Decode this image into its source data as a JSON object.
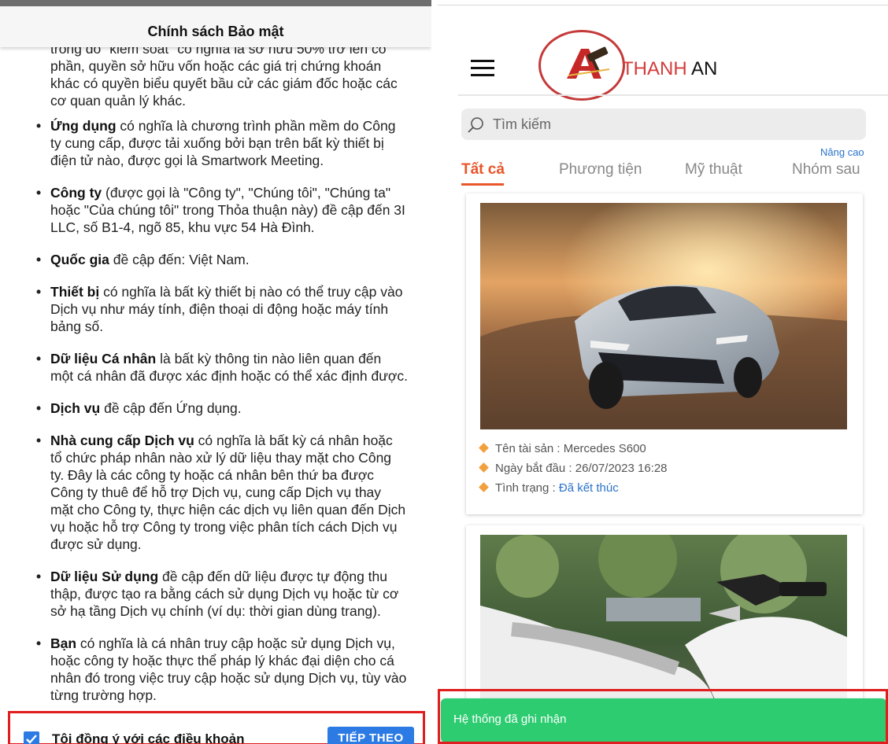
{
  "privacy": {
    "header_title": "Chính sách Bảo mật",
    "cut_paragraph": "trong đó \"kiểm soát\" có nghĩa là sở hữu 50% trở lên cổ phần, quyền sở hữu vốn hoặc các giá trị chứng khoán khác có quyền biểu quyết bầu cử các giám đốc hoặc các cơ quan quản lý khác.",
    "items": [
      {
        "term": "Ứng dụng",
        "text": " có nghĩa là chương trình phần mềm do Công ty cung cấp, được tải xuống bởi bạn trên bất kỳ thiết bị điện tử nào, được gọi là Smartwork Meeting."
      },
      {
        "term": "Công ty",
        "text": " (được gọi là \"Công ty\", \"Chúng tôi\", \"Chúng ta\" hoặc \"Của chúng tôi\" trong Thỏa thuận này) đề cập đến 3I LLC, số B1-4, ngõ 85, khu vực 54 Hà Đình."
      },
      {
        "term": "Quốc gia",
        "text": " đề cập đến: Việt Nam."
      },
      {
        "term": "Thiết bị",
        "text": " có nghĩa là bất kỳ thiết bị nào có thể truy cập vào Dịch vụ như máy tính, điện thoại di động hoặc máy tính bảng số."
      },
      {
        "term": "Dữ liệu Cá nhân",
        "text": " là bất kỳ thông tin nào liên quan đến một cá nhân đã được xác định hoặc có thể xác định được."
      },
      {
        "term": "Dịch vụ",
        "text": " đề cập đến Ứng dụng."
      },
      {
        "term": "Nhà cung cấp Dịch vụ",
        "text": " có nghĩa là bất kỳ cá nhân hoặc tổ chức pháp nhân nào xử lý dữ liệu thay mặt cho Công ty. Đây là các công ty hoặc cá nhân bên thứ ba được Công ty thuê để hỗ trợ Dịch vụ, cung cấp Dịch vụ thay mặt cho Công ty, thực hiện các dịch vụ liên quan đến Dịch vụ hoặc hỗ trợ Công ty trong việc phân tích cách Dịch vụ được sử dụng."
      },
      {
        "term": "Dữ liệu Sử dụng",
        "text": " đề cập đến dữ liệu được tự động thu thập, được tạo ra bằng cách sử dụng Dịch vụ hoặc từ cơ sở hạ tầng Dịch vụ chính (ví dụ: thời gian dùng trang)."
      },
      {
        "term": "Bạn",
        "text": " có nghĩa là cá nhân truy cập hoặc sử dụng Dịch vụ, hoặc công ty hoặc thực thể pháp lý khác đại diện cho cá nhân đó trong việc truy cập hoặc sử dụng Dịch vụ, tùy vào từng trường hợp."
      }
    ],
    "agree_label": "Tôi đồng ý với các điều khoản",
    "agree_checked": true,
    "next_button": "TIẾP THEO"
  },
  "app": {
    "brand_part1": "THANH",
    "brand_part2": " AN",
    "search_placeholder": "Tìm kiếm",
    "advanced_link": "Nâng cao",
    "tabs": [
      "Tất cả",
      "Phương tiện",
      "Mỹ thuật",
      "Nhóm sau"
    ],
    "active_tab": "Tất cả",
    "card1": {
      "name_label": "Tên tài sản : ",
      "name_value": "Mercedes S600",
      "start_label": "Ngày bắt đầu : ",
      "start_value": "26/07/2023 16:28",
      "status_label": "Tình trạng : ",
      "status_value": "Đã kết thúc"
    },
    "toast": "Hệ thống đã ghi nhận"
  },
  "colors": {
    "accent_blue": "#2c7be5",
    "tab_active": "#e9562a",
    "toast_green": "#2ecc71",
    "highlight_red": "#e01e1e",
    "bullet_orange": "#f2a03d"
  }
}
